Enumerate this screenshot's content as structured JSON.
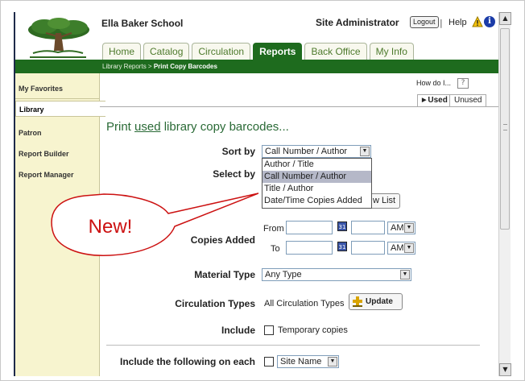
{
  "header": {
    "school_name": "Ella Baker School",
    "user_role": "Site Administrator",
    "logout_label": "Logout",
    "separator": "|",
    "help_label": "Help"
  },
  "tabs": [
    {
      "label": "Home",
      "active": false
    },
    {
      "label": "Catalog",
      "active": false
    },
    {
      "label": "Circulation",
      "active": false
    },
    {
      "label": "Reports",
      "active": true
    },
    {
      "label": "Back Office",
      "active": false
    },
    {
      "label": "My Info",
      "active": false
    }
  ],
  "breadcrumb": {
    "parent": "Library Reports >",
    "current": "Print Copy Barcodes"
  },
  "sidebar": {
    "items": [
      {
        "label": "My Favorites"
      },
      {
        "label": "Library"
      },
      {
        "label": "Patron"
      },
      {
        "label": "Report Builder"
      },
      {
        "label": "Report Manager"
      }
    ]
  },
  "help_bar": {
    "how_do_i": "How do I...",
    "question": "?"
  },
  "subtabs": {
    "used": "Used",
    "unused": "Unused"
  },
  "page": {
    "title_prefix": "Print ",
    "title_link": "used",
    "title_suffix": " library copy barcodes..."
  },
  "form": {
    "sort_by_label": "Sort by",
    "sort_by_value": "Call Number / Author",
    "sort_options": [
      "Author / Title",
      "Call Number / Author",
      "Title / Author",
      "Date/Time Copies Added"
    ],
    "select_by_label": "Select by",
    "list_button_partial": "w List",
    "copies_added_label": "Copies Added",
    "from_label": "From",
    "to_label": "To",
    "ampm_value": "AM",
    "material_type_label": "Material Type",
    "material_type_value": "Any Type",
    "circ_types_label": "Circulation Types",
    "circ_types_value": "All Circulation Types",
    "update_label": "Update",
    "include_label": "Include",
    "temporary_copies_label": "Temporary copies",
    "include_each_label": "Include the following on each",
    "site_name_value": "Site Name"
  },
  "callout": {
    "text": "New!",
    "color": "#cc1111"
  },
  "colors": {
    "brand_green": "#1e6b1e",
    "sidebar_bg": "#f7f4cf",
    "title_green": "#2a6a36"
  }
}
